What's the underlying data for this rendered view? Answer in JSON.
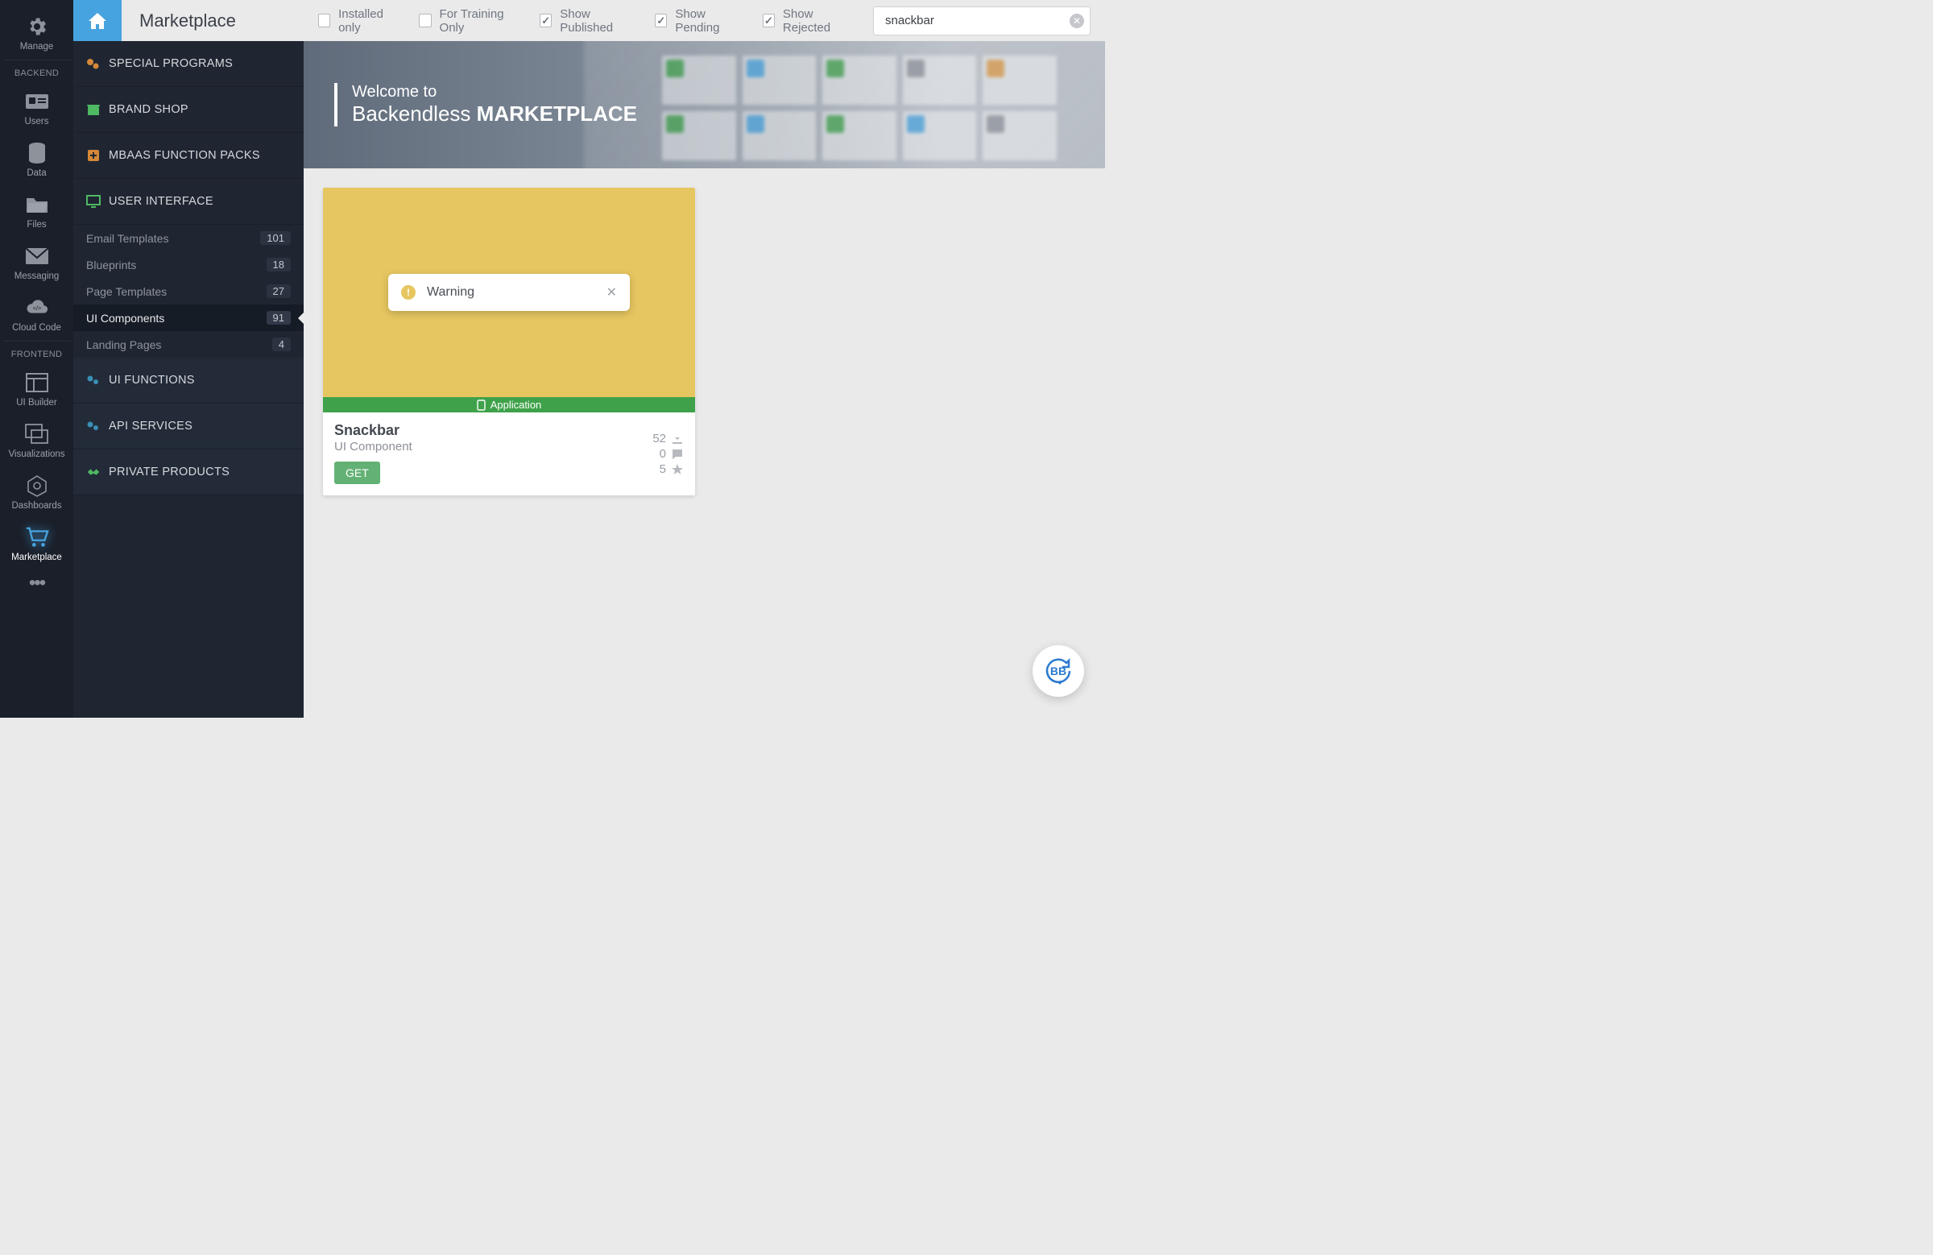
{
  "page": {
    "title": "Marketplace"
  },
  "rail": {
    "manage": "Manage",
    "backend_label": "BACKEND",
    "users": "Users",
    "data": "Data",
    "files": "Files",
    "messaging": "Messaging",
    "cloud_code": "Cloud Code",
    "frontend_label": "FRONTEND",
    "ui_builder": "UI Builder",
    "visualizations": "Visualizations",
    "dashboards": "Dashboards",
    "marketplace": "Marketplace"
  },
  "categories": {
    "special_programs": "SPECIAL PROGRAMS",
    "brand_shop": "BRAND SHOP",
    "mbaas_function_packs": "MBAAS FUNCTION PACKS",
    "user_interface": "USER INTERFACE",
    "ui_functions": "UI FUNCTIONS",
    "api_services": "API SERVICES",
    "private_products": "PRIVATE PRODUCTS",
    "subs": {
      "email_templates": {
        "label": "Email Templates",
        "count": "101"
      },
      "blueprints": {
        "label": "Blueprints",
        "count": "18"
      },
      "page_templates": {
        "label": "Page Templates",
        "count": "27"
      },
      "ui_components": {
        "label": "UI Components",
        "count": "91"
      },
      "landing_pages": {
        "label": "Landing Pages",
        "count": "4"
      }
    }
  },
  "toolbar": {
    "installed_only": "Installed only",
    "for_training_only": "For Training Only",
    "show_published": "Show Published",
    "show_pending": "Show Pending",
    "show_rejected": "Show Rejected",
    "search_value": "snackbar"
  },
  "banner": {
    "line1": "Welcome to",
    "line2_a": "Backendless",
    "line2_b": "MARKETPLACE"
  },
  "card": {
    "tag": "Application",
    "preview_text": "Warning",
    "title": "Snackbar",
    "subtitle": "UI Component",
    "get": "GET",
    "downloads": "52",
    "comments": "0",
    "stars": "5"
  },
  "fab": {
    "text": "BB"
  }
}
